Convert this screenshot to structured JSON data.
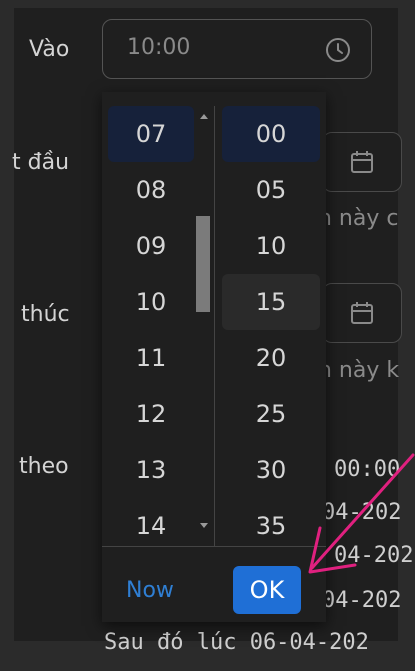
{
  "form": {
    "label_vao": "Vào",
    "time_value": "10:00",
    "label_start": "t đầu",
    "label_end": "thúc",
    "label_theo": "theo",
    "start_hint": "n này c",
    "end_hint": "n này k",
    "schedule_time": "00:00",
    "dates": [
      "04-202",
      "04-202",
      "04-202"
    ],
    "bottom_text": "Sau đó lúc 06-04-202"
  },
  "picker": {
    "hours": [
      "07",
      "08",
      "09",
      "10",
      "11",
      "12",
      "13",
      "14"
    ],
    "minutes": [
      "00",
      "05",
      "10",
      "15",
      "20",
      "25",
      "30",
      "35"
    ],
    "selected_hour": "07",
    "selected_minute": "00",
    "hovered_minute": "15",
    "now_label": "Now",
    "ok_label": "OK"
  },
  "colors": {
    "accent": "#1f6fd6",
    "link": "#2f7fd4",
    "annotation_arrow": "#e0207f"
  },
  "icons": {
    "time_input_icon": "clock-icon",
    "date_field_icon": "calendar-icon",
    "scroll_icons": [
      "chevron-up-icon",
      "chevron-down-icon"
    ],
    "annotation": "arrow-annotation-icon"
  }
}
